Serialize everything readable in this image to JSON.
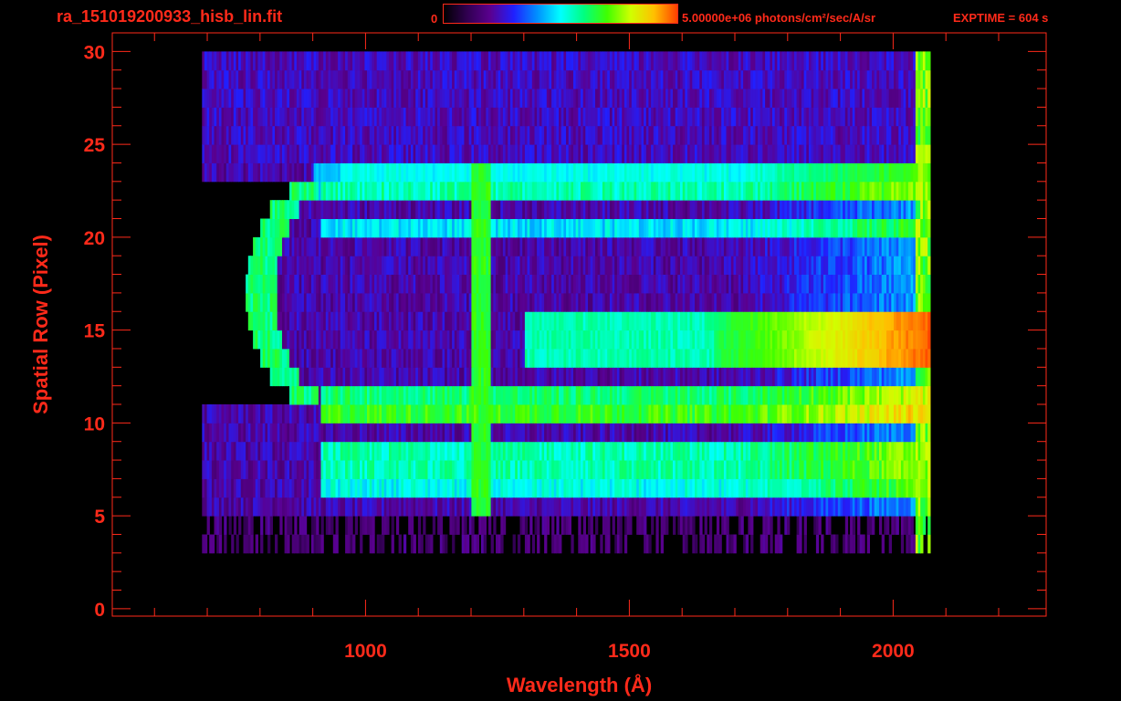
{
  "header": {
    "file_title": "ra_151019200933_hisb_lin.fit",
    "colorbar_min_label": "0",
    "colorbar_max_label": "5.00000e+06 photons/cm²/sec/A/sr",
    "exptime_label": "EXPTIME = 604 s"
  },
  "colors": {
    "axis": "#ff2a1a",
    "background": "#000000",
    "colormap": [
      "#000000",
      "#300050",
      "#5a0090",
      "#2020ff",
      "#0090ff",
      "#00ffff",
      "#00ff80",
      "#40ff00",
      "#d0ff00",
      "#ffc000",
      "#ff4000"
    ]
  },
  "chart_data": {
    "type": "heatmap",
    "title": "ra_151019200933_hisb_lin.fit",
    "xlabel": "Wavelength (Å)",
    "ylabel": "Spatial Row (Pixel)",
    "xlim": [
      520,
      2290
    ],
    "ylim": [
      -0.4,
      31.0
    ],
    "x_ticks": [
      1000,
      1500,
      2000
    ],
    "x_minor_step": 100,
    "y_ticks": [
      0,
      5,
      10,
      15,
      20,
      25,
      30
    ],
    "y_minor_step": 1,
    "grid": false,
    "colorbar": {
      "min": 0,
      "max": 5000000,
      "units": "photons/cm²/sec/A/sr"
    },
    "exposure_time_s": 604,
    "data_x_range": [
      690,
      2070
    ],
    "data_row_range": [
      3,
      30
    ],
    "features": {
      "arc_rows": [
        11,
        23
      ],
      "arc_min_wavelength": 800,
      "vertical_line_wavelength": 1216,
      "vertical_line_rows": [
        5,
        24
      ],
      "bright_band_rows": [
        12.5,
        16.0
      ],
      "bright_band_range": [
        1660,
        2060
      ],
      "peak_fraction": 0.95,
      "horizontal_bands": [
        {
          "row": 22.5,
          "level": 0.5
        },
        {
          "row": 20.5,
          "level": 0.42
        },
        {
          "row": 11.5,
          "level": 0.55
        },
        {
          "row": 10.5,
          "level": 0.62
        },
        {
          "row": 8.0,
          "level": 0.5
        },
        {
          "row": 6.5,
          "level": 0.45
        }
      ]
    }
  }
}
